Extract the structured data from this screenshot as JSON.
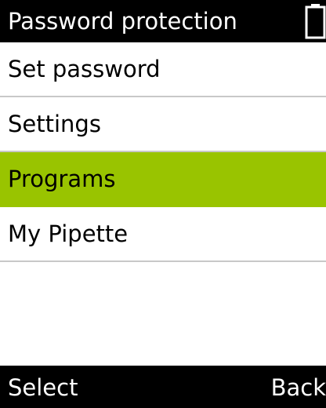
{
  "header": {
    "title": "Password protection",
    "battery_icon": "battery-icon"
  },
  "menu": {
    "items": [
      {
        "label": "Set password",
        "selected": false
      },
      {
        "label": "Settings",
        "selected": false
      },
      {
        "label": "Programs",
        "selected": true
      },
      {
        "label": "My Pipette",
        "selected": false
      }
    ]
  },
  "softkeys": {
    "left_label": "Select",
    "right_label": "Back"
  },
  "colors": {
    "header_bg": "#000000",
    "selected_bg": "#99c400",
    "divider": "#c8c8c8"
  }
}
